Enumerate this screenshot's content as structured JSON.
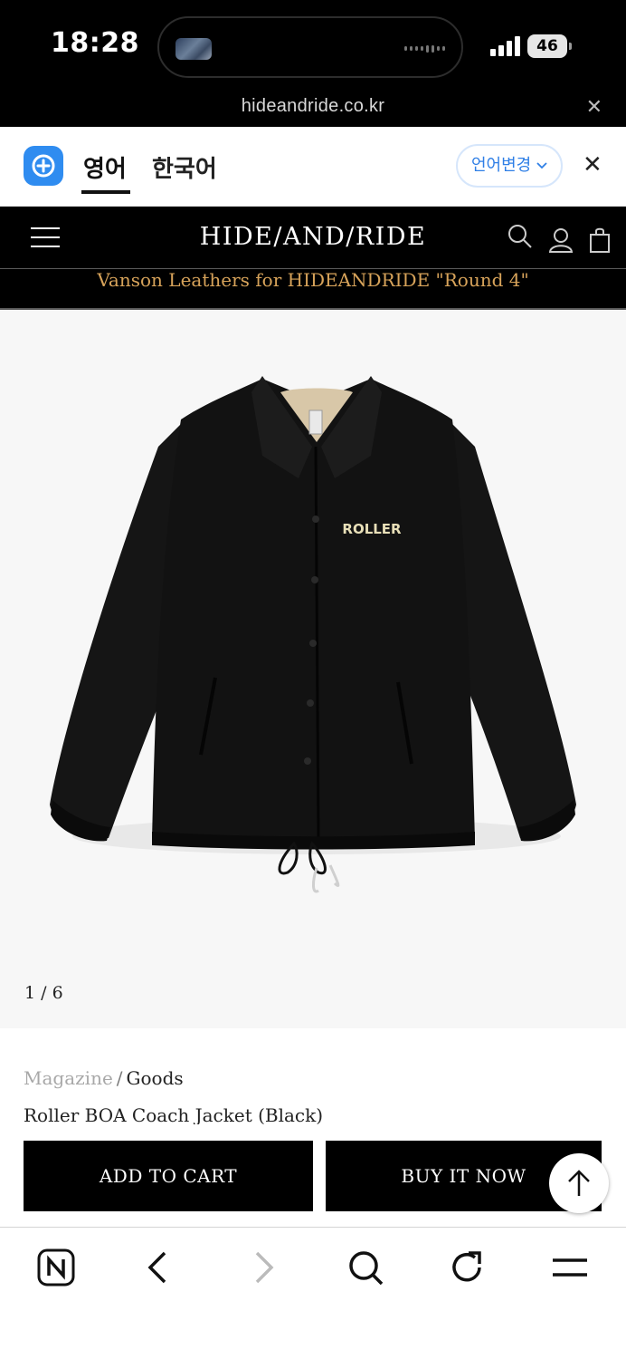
{
  "status_bar": {
    "time": "18:28",
    "battery": "46"
  },
  "browser": {
    "url": "hideandride.co.kr"
  },
  "translate_bar": {
    "tab_english": "영어",
    "tab_korean": "한국어",
    "change_language": "언어변경"
  },
  "site": {
    "brand": "HIDE/AND/RIDE",
    "announcement": "Vanson Leathers for HIDEANDRIDE \"Round 4\""
  },
  "product": {
    "print_text": "ROLLER",
    "image_counter": "1 / 6",
    "breadcrumb": {
      "parent": "Magazine",
      "separator": "/",
      "current": "Goods"
    },
    "name": "Roller BOA Coach Jacket (Black)"
  },
  "actions": {
    "add_to_cart": "ADD TO CART",
    "buy_now": "BUY IT NOW"
  },
  "colors": {
    "announcement_text": "#d7a35a",
    "translate_accent": "#2f7fe6",
    "header_bg": "#000000"
  }
}
